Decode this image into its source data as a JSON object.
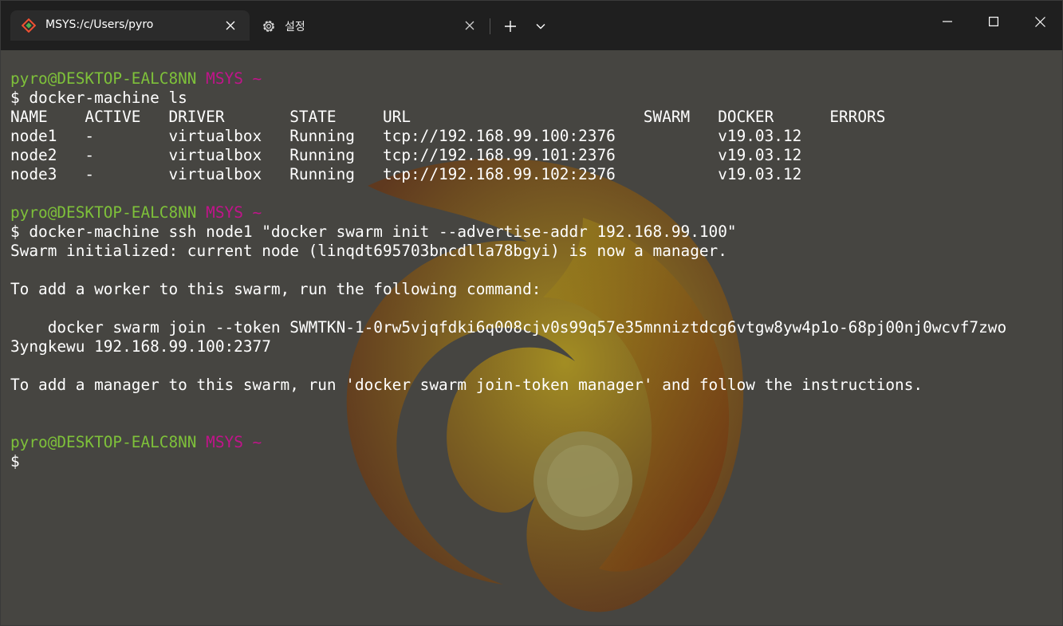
{
  "tabs": [
    {
      "title": "MSYS:/c/Users/pyro",
      "icon": "git-bash-icon",
      "active": true
    },
    {
      "title": "설정",
      "icon": "gear-icon",
      "active": false
    }
  ],
  "colors": {
    "prompt_user": "#7ec13a",
    "prompt_msys": "#c0148a",
    "text": "#ffffff",
    "background": "#464541",
    "titlebar": "#1f1f1f"
  },
  "terminal": {
    "lines": [
      [
        {
          "t": "pyro@DESKTOP-EALC8NN ",
          "c": "g"
        },
        {
          "t": "MSYS ~",
          "c": "m"
        }
      ],
      [
        {
          "t": "$ docker-machine ls"
        }
      ],
      [
        {
          "t": "NAME    ACTIVE   DRIVER       STATE     URL                         SWARM   DOCKER      ERRORS"
        }
      ],
      [
        {
          "t": "node1   -        virtualbox   Running   tcp://192.168.99.100:2376           v19.03.12"
        }
      ],
      [
        {
          "t": "node2   -        virtualbox   Running   tcp://192.168.99.101:2376           v19.03.12"
        }
      ],
      [
        {
          "t": "node3   -        virtualbox   Running   tcp://192.168.99.102:2376           v19.03.12"
        }
      ],
      [
        {
          "t": ""
        }
      ],
      [
        {
          "t": "pyro@DESKTOP-EALC8NN ",
          "c": "g"
        },
        {
          "t": "MSYS ~",
          "c": "m"
        }
      ],
      [
        {
          "t": "$ docker-machine ssh node1 \"docker swarm init --advertise-addr 192.168.99.100\""
        }
      ],
      [
        {
          "t": "Swarm initialized: current node (linqdt695703bncdlla78bgyi) is now a manager."
        }
      ],
      [
        {
          "t": ""
        }
      ],
      [
        {
          "t": "To add a worker to this swarm, run the following command:"
        }
      ],
      [
        {
          "t": ""
        }
      ],
      [
        {
          "t": "    docker swarm join --token SWMTKN-1-0rw5vjqfdki6q008cjv0s99q57e35mnniztdcg6vtgw8yw4p1o-68pj00nj0wcvf7zwo"
        }
      ],
      [
        {
          "t": "3yngkewu 192.168.99.100:2377"
        }
      ],
      [
        {
          "t": ""
        }
      ],
      [
        {
          "t": "To add a manager to this swarm, run 'docker swarm join-token manager' and follow the instructions."
        }
      ],
      [
        {
          "t": ""
        }
      ],
      [
        {
          "t": ""
        }
      ],
      [
        {
          "t": "pyro@DESKTOP-EALC8NN ",
          "c": "g"
        },
        {
          "t": "MSYS ~",
          "c": "m"
        }
      ],
      [
        {
          "t": "$"
        }
      ]
    ]
  }
}
